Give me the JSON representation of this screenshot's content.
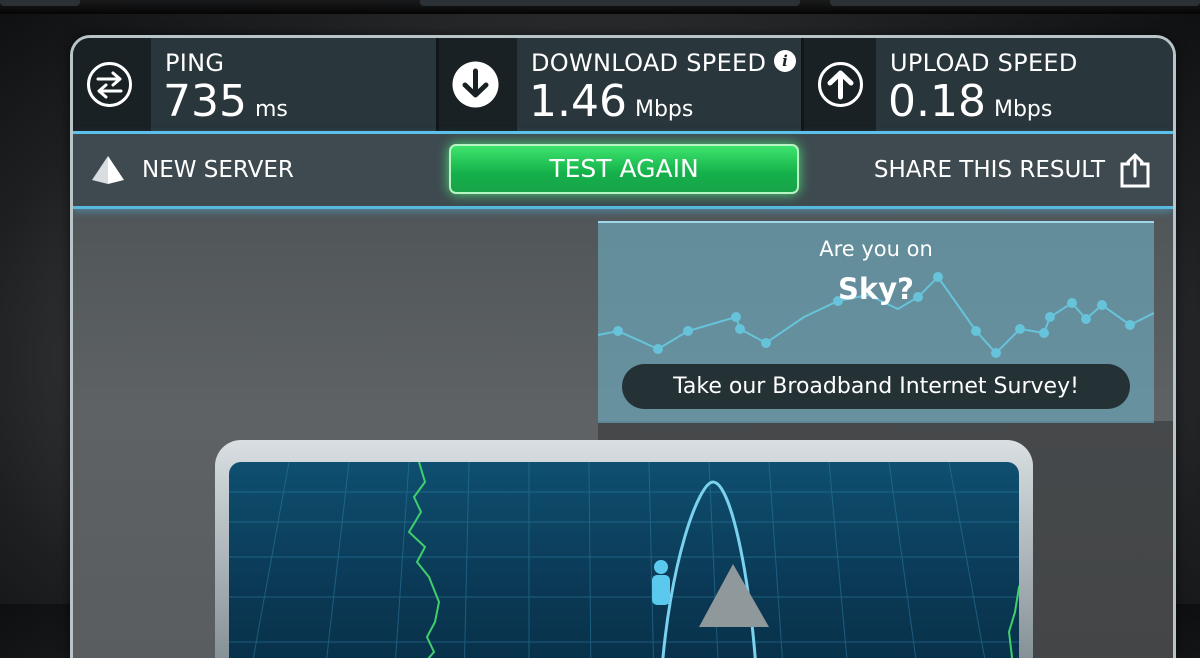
{
  "results": {
    "ping": {
      "label": "PING",
      "value": "735",
      "unit": "ms",
      "icon": "ping-arrows-icon"
    },
    "download": {
      "label": "DOWNLOAD SPEED",
      "value": "1.46",
      "unit": "Mbps",
      "icon": "download-arrow-icon",
      "info": "i"
    },
    "upload": {
      "label": "UPLOAD SPEED",
      "value": "0.18",
      "unit": "Mbps",
      "icon": "upload-arrow-icon"
    }
  },
  "actions": {
    "new_server": "NEW SERVER",
    "test_again": "TEST AGAIN",
    "share": "SHARE THIS RESULT"
  },
  "survey": {
    "line1": "Are you on",
    "line2": "Sky?",
    "cta": "Take our Broadband Internet Survey!"
  },
  "colors": {
    "accent_blue": "#5fc2ea",
    "test_button_green": "#22c456",
    "map_route_green": "#3fcf6b"
  }
}
